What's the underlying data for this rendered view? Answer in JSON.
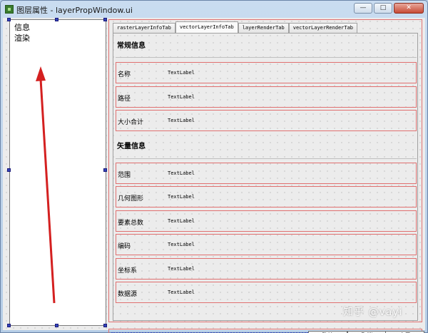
{
  "window": {
    "title": "图层属性 - layerPropWindow.ui",
    "minimize_glyph": "—",
    "maximize_glyph": "□",
    "close_glyph": "✕"
  },
  "left_list": {
    "items": [
      "信息",
      "渲染"
    ]
  },
  "tabs": [
    "rasterLayerInfoTab",
    "vectorLayerInfoTab",
    "layerRenderTab",
    "vectorLayerRenderTab"
  ],
  "active_tab": "vectorLayerInfoTab",
  "sections": {
    "general": {
      "heading": "常规信息",
      "rows": [
        {
          "label": "名称",
          "value": "TextLabel"
        },
        {
          "label": "路径",
          "value": "TextLabel"
        },
        {
          "label": "大小合计",
          "value": "TextLabel"
        }
      ]
    },
    "vector": {
      "heading": "矢量信息",
      "rows": [
        {
          "label": "范围",
          "value": "TextLabel"
        },
        {
          "label": "几何图形",
          "value": "TextLabel"
        },
        {
          "label": "要素总数",
          "value": "TextLabel"
        },
        {
          "label": "编码",
          "value": "TextLabel"
        },
        {
          "label": "坐标系",
          "value": "TextLabel"
        },
        {
          "label": "数据源",
          "value": "TextLabel"
        }
      ]
    }
  },
  "buttons": {
    "confirm": "确认",
    "cancel": "取消",
    "apply": "应用"
  },
  "watermark": "知乎 @vayi",
  "colors": {
    "frame_red": "#e07070",
    "handle_blue": "#3344bb",
    "arrow_red": "#d42020"
  }
}
